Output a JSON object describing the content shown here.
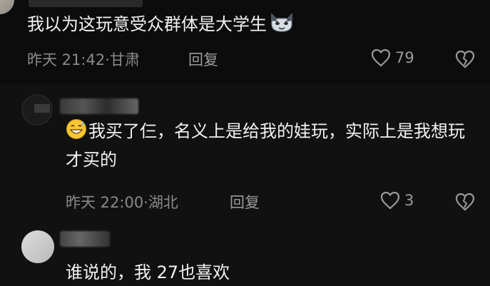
{
  "comments": [
    {
      "text": "我以为这玩意受众群体是大学生",
      "emoji": "cat-face-emoji",
      "time": "昨天 21:42",
      "location": "甘肃",
      "reply_label": "回复",
      "likes": "79"
    },
    {
      "text": "我买了仨，名义上是给我的娃玩，实际上是我想玩才买的",
      "emoji": "grinning-sweat-emoji",
      "time": "昨天 22:00",
      "location": "湖北",
      "reply_label": "回复",
      "likes": "3"
    },
    {
      "text": "谁说的，我 27也喜欢"
    }
  ],
  "colors": {
    "background": "#0b0b0b",
    "text": "#f2f2f2",
    "meta": "#8a8a8a"
  }
}
